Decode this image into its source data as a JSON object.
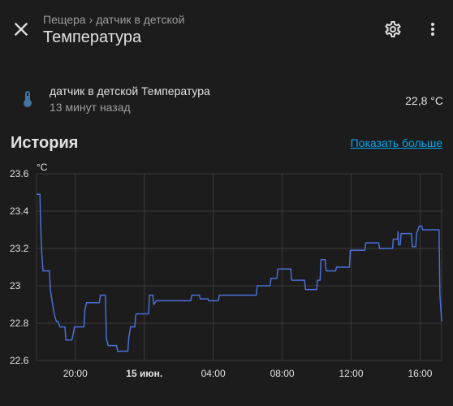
{
  "header": {
    "breadcrumb_parent": "Пещера",
    "breadcrumb_sep": "›",
    "breadcrumb_child": "датчик в детской",
    "title": "Температура"
  },
  "entity": {
    "name": "датчик в детской Температура",
    "last_changed": "13 минут назад",
    "state": "22,8 °C",
    "icon": "thermometer-icon"
  },
  "history": {
    "title": "История",
    "show_more": "Показать больше"
  },
  "colors": {
    "background": "#1c1c1c",
    "line": "#4a6fd8",
    "link": "#03a9f4",
    "grid": "#3a3a3a",
    "icon": "#44739e"
  },
  "chart_data": {
    "type": "line",
    "title": "",
    "unit": "°C",
    "xlabel": "",
    "ylabel": "°C",
    "ylim": [
      22.6,
      23.6
    ],
    "yticks": [
      "23.6",
      "23.4",
      "23.2",
      "23",
      "22.8",
      "22.6"
    ],
    "xrange_hours": [
      17.75,
      41.25
    ],
    "xticks": [
      {
        "label": "20:00",
        "hour": 20,
        "bold": false
      },
      {
        "label": "15 июн.",
        "hour": 24,
        "bold": true
      },
      {
        "label": "04:00",
        "hour": 28,
        "bold": false
      },
      {
        "label": "08:00",
        "hour": 32,
        "bold": false
      },
      {
        "label": "12:00",
        "hour": 36,
        "bold": false
      },
      {
        "label": "16:00",
        "hour": 40,
        "bold": false
      }
    ],
    "grid": true,
    "series": [
      {
        "points": [
          [
            17.75,
            23.49
          ],
          [
            17.95,
            23.49
          ],
          [
            17.98,
            23.35
          ],
          [
            18.05,
            23.18
          ],
          [
            18.12,
            23.08
          ],
          [
            18.5,
            23.08
          ],
          [
            18.55,
            22.98
          ],
          [
            18.7,
            22.89
          ],
          [
            18.8,
            22.84
          ],
          [
            18.9,
            22.81
          ],
          [
            19.0,
            22.81
          ],
          [
            19.1,
            22.78
          ],
          [
            19.4,
            22.78
          ],
          [
            19.45,
            22.71
          ],
          [
            19.8,
            22.71
          ],
          [
            19.85,
            22.73
          ],
          [
            19.95,
            22.78
          ],
          [
            20.5,
            22.78
          ],
          [
            20.55,
            22.87
          ],
          [
            20.65,
            22.91
          ],
          [
            21.4,
            22.91
          ],
          [
            21.45,
            22.95
          ],
          [
            21.75,
            22.95
          ],
          [
            21.8,
            22.72
          ],
          [
            21.9,
            22.68
          ],
          [
            22.4,
            22.68
          ],
          [
            22.45,
            22.65
          ],
          [
            23.05,
            22.65
          ],
          [
            23.1,
            22.72
          ],
          [
            23.2,
            22.78
          ],
          [
            23.45,
            22.78
          ],
          [
            23.5,
            22.84
          ],
          [
            23.55,
            22.85
          ],
          [
            24.25,
            22.85
          ],
          [
            24.3,
            22.95
          ],
          [
            24.5,
            22.95
          ],
          [
            24.55,
            22.9
          ],
          [
            24.7,
            22.92
          ],
          [
            26.7,
            22.92
          ],
          [
            26.75,
            22.95
          ],
          [
            27.2,
            22.95
          ],
          [
            27.25,
            22.93
          ],
          [
            27.7,
            22.93
          ],
          [
            27.75,
            22.92
          ],
          [
            28.3,
            22.92
          ],
          [
            28.35,
            22.95
          ],
          [
            30.5,
            22.95
          ],
          [
            30.55,
            23.0
          ],
          [
            31.3,
            23.0
          ],
          [
            31.35,
            23.04
          ],
          [
            31.7,
            23.04
          ],
          [
            31.75,
            23.09
          ],
          [
            32.5,
            23.09
          ],
          [
            32.55,
            23.03
          ],
          [
            33.3,
            23.03
          ],
          [
            33.35,
            22.98
          ],
          [
            34.0,
            22.98
          ],
          [
            34.05,
            23.03
          ],
          [
            34.2,
            23.03
          ],
          [
            34.25,
            23.14
          ],
          [
            34.5,
            23.14
          ],
          [
            34.55,
            23.08
          ],
          [
            35.1,
            23.08
          ],
          [
            35.15,
            23.1
          ],
          [
            35.9,
            23.1
          ],
          [
            35.95,
            23.19
          ],
          [
            36.8,
            23.19
          ],
          [
            36.85,
            23.23
          ],
          [
            37.6,
            23.23
          ],
          [
            37.65,
            23.2
          ],
          [
            38.4,
            23.2
          ],
          [
            38.45,
            23.25
          ],
          [
            38.7,
            23.25
          ],
          [
            38.72,
            23.29
          ],
          [
            38.75,
            23.22
          ],
          [
            38.85,
            23.22
          ],
          [
            38.9,
            23.28
          ],
          [
            39.5,
            23.28
          ],
          [
            39.55,
            23.21
          ],
          [
            39.75,
            23.21
          ],
          [
            39.8,
            23.28
          ],
          [
            39.95,
            23.32
          ],
          [
            40.1,
            23.32
          ],
          [
            40.15,
            23.3
          ],
          [
            41.1,
            23.3
          ],
          [
            41.15,
            22.95
          ],
          [
            41.25,
            22.81
          ]
        ]
      }
    ]
  }
}
